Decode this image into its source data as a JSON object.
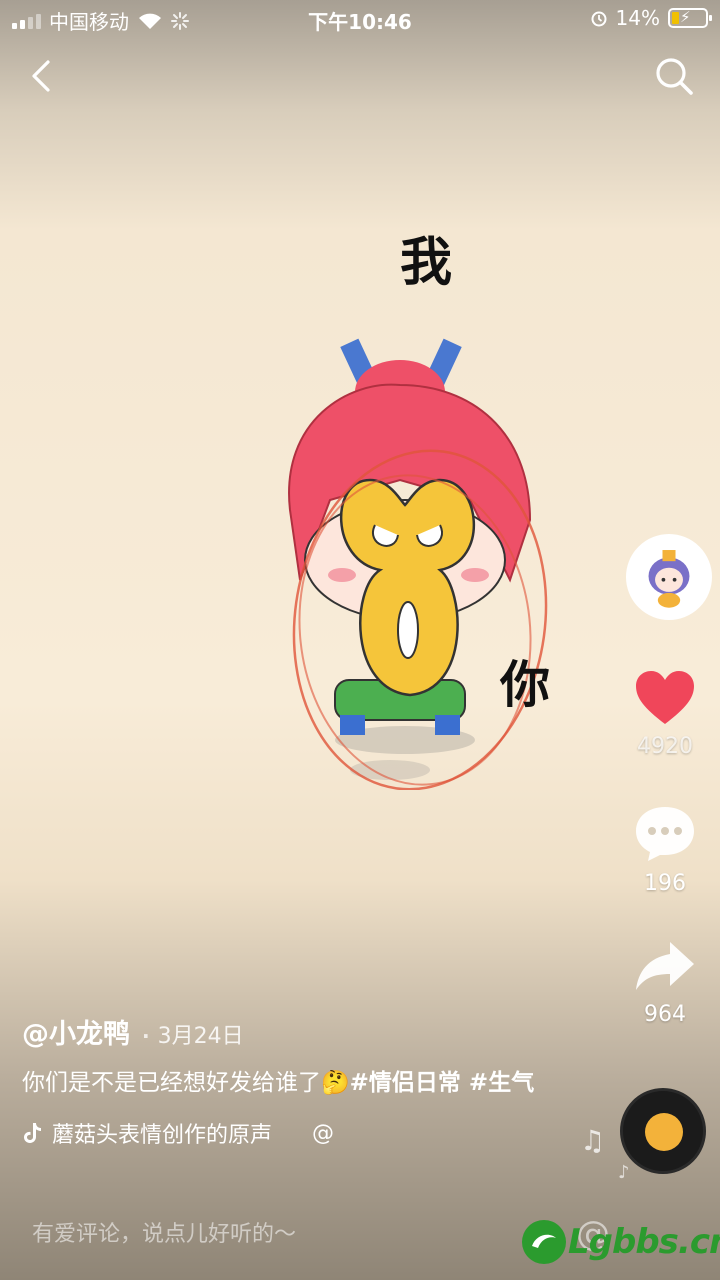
{
  "status": {
    "carrier": "中国移动",
    "time": "下午10:46",
    "battery": "14%"
  },
  "video": {
    "overlay_top": "我",
    "overlay_right": "你"
  },
  "actions": {
    "likes": "4920",
    "comments": "196",
    "shares": "964"
  },
  "post": {
    "author": "@小龙鸭",
    "separator": "·",
    "date": "3月24日",
    "caption": "你们是不是已经想好发给谁了",
    "emoji": "🤔",
    "hashtags": "#情侣日常 #生气",
    "music": "蘑菇头表情创作的原声",
    "music_at": "@"
  },
  "comment_bar": {
    "placeholder": "有爱评论，说点儿好听的～",
    "at": "@"
  },
  "watermark": {
    "text": "Lgbbs.cn"
  },
  "colors": {
    "like": "#f0465a",
    "watermark": "#2b9b2e"
  },
  "icons": [
    "back-icon",
    "search-icon",
    "heart-icon",
    "comment-icon",
    "share-icon",
    "music-note-icon",
    "disc-icon"
  ]
}
